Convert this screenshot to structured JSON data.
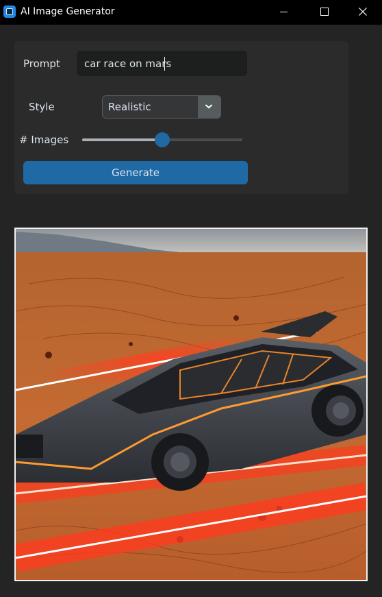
{
  "window": {
    "title": "AI Image Generator",
    "icon": "app-window-icon"
  },
  "form": {
    "prompt_label": "Prompt",
    "prompt_value": "car race on mars",
    "style_label": "Style",
    "style_selected": "Realistic",
    "images_label": "# Images",
    "images_slider_level": 0.5,
    "generate_label": "Generate"
  },
  "colors": {
    "accent": "#1f6aa5",
    "background": "#242424",
    "panel": "#2b2b2b"
  }
}
